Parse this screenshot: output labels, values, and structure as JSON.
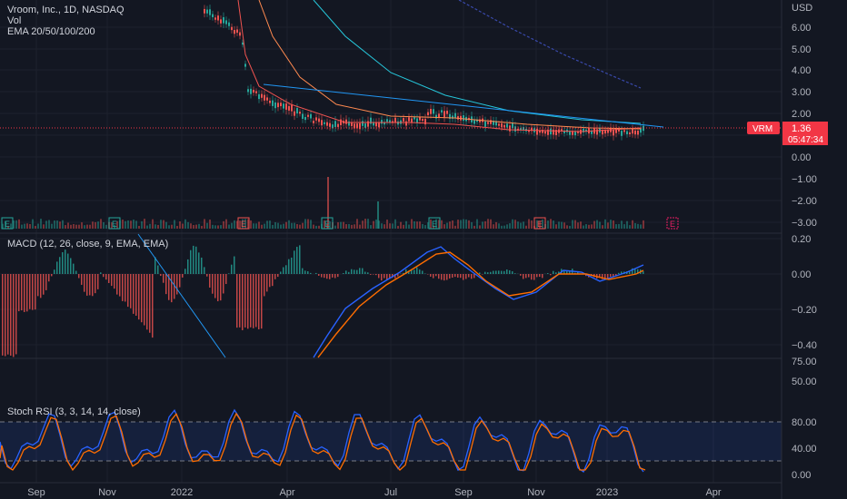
{
  "header": {
    "symbol_line": "Vroom, Inc., 1D, NASDAQ",
    "vol_label": "Vol",
    "ema_label": "EMA 20/50/100/200"
  },
  "price_axis": {
    "currency": "USD",
    "ticks": [
      "6.00",
      "5.00",
      "4.00",
      "3.00",
      "2.00",
      "1.00",
      "0.00",
      "−1.00",
      "−2.00",
      "−3.00"
    ],
    "ticker_badge": "VRM",
    "last_price": "1.36",
    "countdown": "05:47:34"
  },
  "macd": {
    "label": "MACD (12, 26, close, 9, EMA, EMA)",
    "ticks": [
      "0.20",
      "0.00",
      "−0.20",
      "−0.40"
    ]
  },
  "stoch": {
    "label": "Stoch RSI (3, 3, 14, 14, close)",
    "ticks_upper": [
      "75.00",
      "50.00"
    ],
    "ticks": [
      "80.00",
      "40.00",
      "0.00"
    ]
  },
  "time_axis": {
    "labels": [
      "Sep",
      "Nov",
      "2022",
      "Apr",
      "Jul",
      "Sep",
      "Nov",
      "2023",
      "Apr"
    ]
  },
  "earnings_markers": [
    "E",
    "E",
    "E",
    "E",
    "E",
    "E",
    "E"
  ],
  "colors": {
    "background": "#131722",
    "up": "#26a69a",
    "down": "#ef5350",
    "macd_line": "#2962ff",
    "signal_line": "#ff6d00",
    "trendline": "#2196f3",
    "ema_teal": "#26c6da",
    "ema_navy": "#3949ab",
    "badge_red": "#f23645"
  },
  "icons": [
    "earnings-up-icon",
    "earnings-down-icon"
  ]
}
